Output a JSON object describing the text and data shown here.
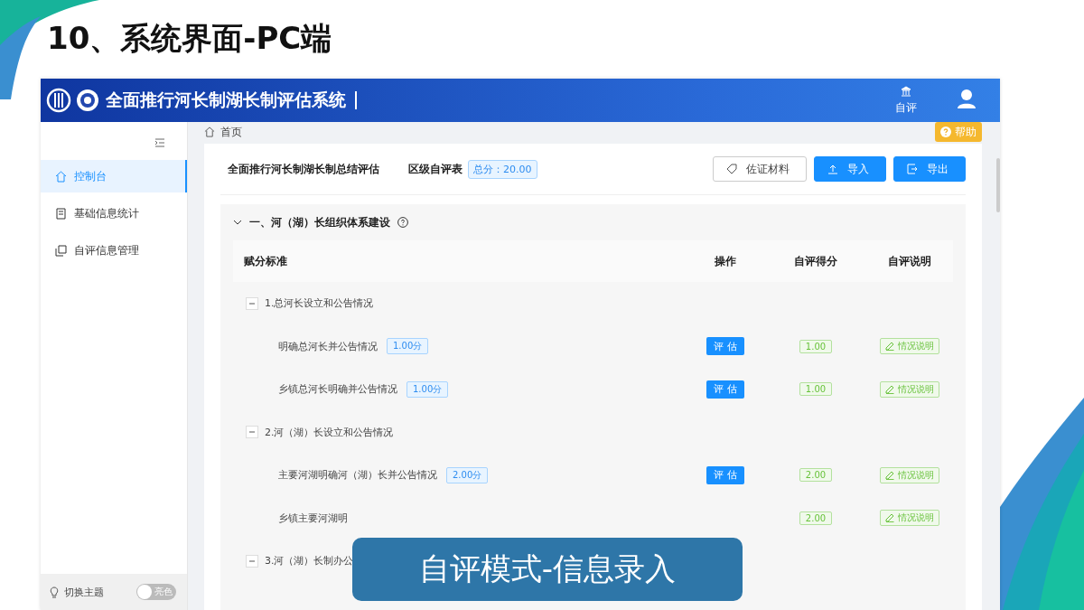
{
  "slide": {
    "title": "10、系统界面-PC端"
  },
  "app": {
    "header": {
      "title": "全面推行河长制湖长制评估系统",
      "nav": {
        "label": "自评"
      }
    },
    "sidebar": {
      "items": [
        {
          "label": "控制台",
          "selected": true
        },
        {
          "label": "基础信息统计",
          "selected": false
        },
        {
          "label": "自评信息管理",
          "selected": false
        }
      ],
      "theme": {
        "label": "切换主题",
        "toggle": {
          "label": "亮色",
          "on": false
        }
      }
    },
    "breadcrumb": "首页",
    "help_button": "帮助",
    "card": {
      "title": "全面推行河长制湖长制总结评估",
      "subtitle": "区级自评表",
      "total_badge": "总分：20.00",
      "buttons": [
        {
          "label": "佐证材料",
          "kind": "evidence"
        },
        {
          "label": "导入",
          "kind": "import"
        },
        {
          "label": "导出",
          "kind": "export"
        }
      ]
    },
    "section": {
      "title": "一、河（湖）长组织体系建设",
      "expanded": true,
      "columns": [
        "赋分标准",
        "操作",
        "自评得分",
        "自评说明"
      ],
      "groups": [
        {
          "label": "1.总河长设立和公告情况",
          "expanded": true,
          "items": [
            {
              "label": "明确总河长并公告情况",
              "points": "1.00分",
              "action": "评 估",
              "score": "1.00",
              "note": "情况说明"
            },
            {
              "label": "乡镇总河长明确并公告情况",
              "points": "1.00分",
              "action": "评 估",
              "score": "1.00",
              "note": "情况说明"
            }
          ]
        },
        {
          "label": "2.河（湖）长设立和公告情况",
          "expanded": true,
          "items": [
            {
              "label": "主要河湖明确河（湖）长并公告情况",
              "points": "2.00分",
              "action": "评 估",
              "score": "2.00",
              "note": "情况说明"
            },
            {
              "label": "乡镇主要河湖明",
              "score": "2.00",
              "note": "情况说明"
            }
          ]
        },
        {
          "label": "3.河（湖）长制办公",
          "expanded": true
        }
      ]
    }
  },
  "caption": "自评模式-信息录入"
}
